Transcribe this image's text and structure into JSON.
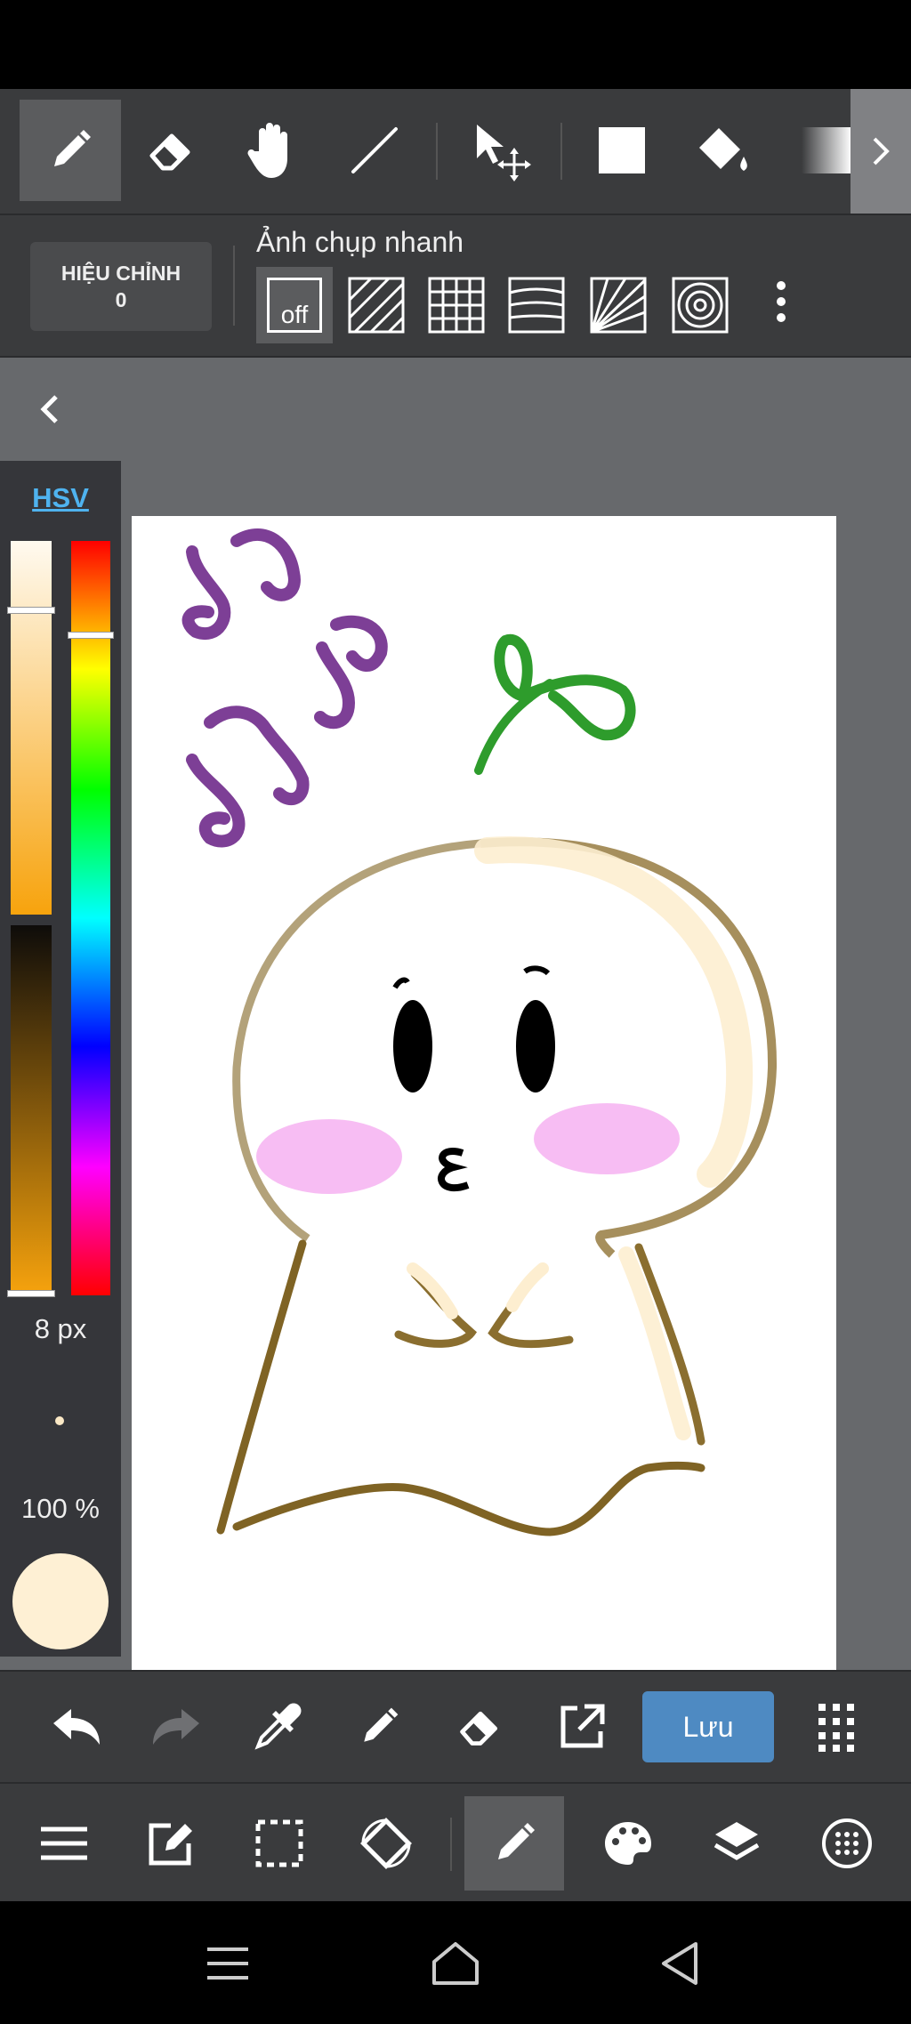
{
  "toolbar": {
    "tools": [
      "pen-tool",
      "eraser-tool",
      "hand-tool",
      "line-tool",
      "move-tool",
      "fill-rect-tool",
      "bucket-tool",
      "gradient-tool"
    ],
    "active_tool": "pen-tool"
  },
  "brush_options": {
    "correction_label": "HIỆU CHỈNH",
    "correction_value": "0",
    "snap_title": "Ảnh chụp nhanh",
    "snap_off_label": "off"
  },
  "color_panel": {
    "mode_tab": "HSV",
    "brush_size": "8 px",
    "opacity": "100 %",
    "current_color": "#fef0d4"
  },
  "action_bar": {
    "save_label": "Lưu"
  },
  "colors": {
    "accent": "#4e8ac2",
    "toolbar_bg": "#3a3b3d",
    "canvas_area_bg": "#67696c",
    "hsv_tab": "#4fb3ef"
  }
}
